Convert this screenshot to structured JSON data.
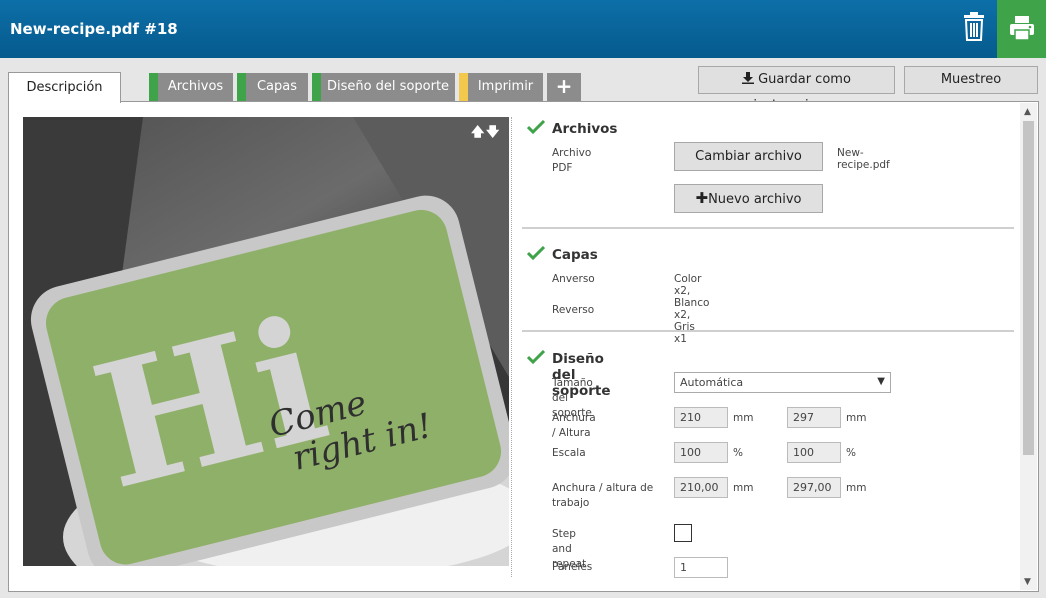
{
  "header": {
    "title": "New-recipe.pdf #18",
    "trash_icon": "trash-icon",
    "print_icon": "printer-icon",
    "print_color": "#3fa34a"
  },
  "tabs": [
    {
      "label": "Descripción",
      "active": true
    },
    {
      "label": "Archivos",
      "color": "#3fa34a"
    },
    {
      "label": "Capas",
      "color": "#3fa34a"
    },
    {
      "label": "Diseño del soporte",
      "color": "#3fa34a"
    },
    {
      "label": "Imprimir",
      "color": "#f2c94c"
    },
    {
      "label": "+"
    }
  ],
  "toolbar": {
    "save_label": "Guardar como instrucciones",
    "proof_label": "Muestreo"
  },
  "preview": {
    "sign_big": "Hi",
    "sign_script_1": "Come",
    "sign_script_2": "right in!"
  },
  "files": {
    "title": "Archivos",
    "pdf_label": "Archivo PDF",
    "change_button": "Cambiar archivo",
    "filename": "New-recipe.pdf",
    "new_button": "Nuevo archivo"
  },
  "layers": {
    "title": "Capas",
    "front_label": "Anverso",
    "front_value": "Color x2, Blanco x2, Gris x1",
    "back_label": "Reverso"
  },
  "media": {
    "title": "Diseño del soporte",
    "size_label": "Tamaño del soporte",
    "size_value": "Automática",
    "wh_label": "Anchura / Altura",
    "width": "210",
    "height": "297",
    "unit_mm": "mm",
    "scale_label": "Escala",
    "scale_x": "100",
    "scale_y": "100",
    "unit_pct": "%",
    "work_label": "Anchura / altura de trabajo",
    "work_width": "210,00",
    "work_height": "297,00",
    "step_label": "Step and repeat",
    "panels_label": "Paneles",
    "panels_value": "1"
  }
}
